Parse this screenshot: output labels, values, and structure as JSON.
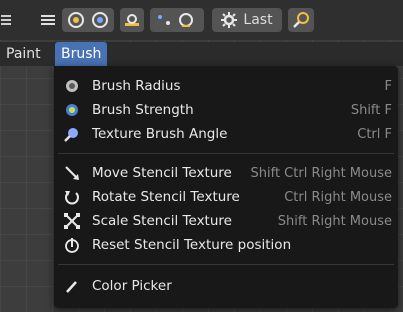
{
  "topbar": {
    "last_label": "Last"
  },
  "menubar": {
    "paint_label": "Paint",
    "brush_label": "Brush"
  },
  "menu": {
    "items": [
      {
        "label": "Brush Radius",
        "shortcut": "F",
        "icon": "brush-radius-icon"
      },
      {
        "label": "Brush Strength",
        "shortcut": "Shift F",
        "icon": "brush-strength-icon"
      },
      {
        "label": "Texture Brush Angle",
        "shortcut": "Ctrl F",
        "icon": "texture-angle-icon"
      },
      {
        "label": "Move Stencil Texture",
        "shortcut": "Shift Ctrl Right Mouse",
        "icon": "move-stencil-icon"
      },
      {
        "label": "Rotate Stencil Texture",
        "shortcut": "Ctrl Right Mouse",
        "icon": "rotate-stencil-icon"
      },
      {
        "label": "Scale Stencil Texture",
        "shortcut": "Shift Right Mouse",
        "icon": "scale-stencil-icon"
      },
      {
        "label": "Reset Stencil Texture position",
        "shortcut": "",
        "icon": "reset-stencil-icon"
      },
      {
        "label": "Color Picker",
        "shortcut": "",
        "icon": "color-picker-icon"
      }
    ]
  },
  "colors": {
    "accent": "#4772b3",
    "menu_bg": "#181818",
    "shortcut_text": "#8a8a8a"
  }
}
